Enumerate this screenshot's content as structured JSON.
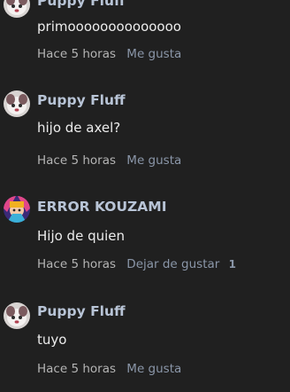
{
  "comments": [
    {
      "author": "Puppy Fluff",
      "text": "primoooooooooooooo",
      "time": "Hace 5 horas",
      "action": "Me gusta",
      "likes": ""
    },
    {
      "author": "Puppy Fluff",
      "text": "hijo de axel?",
      "time": "Hace 5 horas",
      "action": "Me gusta",
      "likes": ""
    },
    {
      "author": "ERROR KOUZAMI",
      "text": "Hijo de quien",
      "time": "Hace 5 horas",
      "action": "Dejar de gustar",
      "likes": "1"
    },
    {
      "author": "Puppy Fluff",
      "text": "tuyo",
      "time": "Hace 5 horas",
      "action": "Me gusta",
      "likes": ""
    }
  ],
  "colors": {
    "background": "#202020",
    "author": "#b8c4d6",
    "meta": "#8a96a8"
  }
}
